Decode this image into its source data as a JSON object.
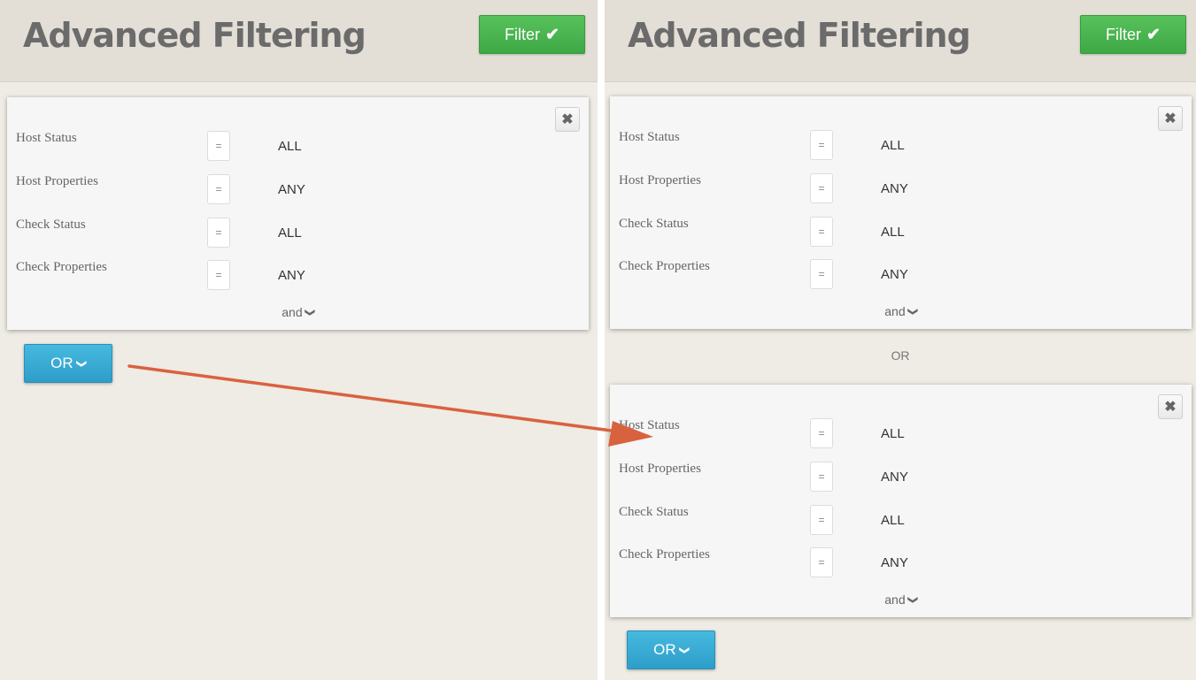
{
  "left_panel": {
    "title": "Advanced Filtering",
    "filter_button": "Filter",
    "or_button": "OR",
    "groups": [
      {
        "rows": [
          {
            "label": "Host Status",
            "operator": "=",
            "value": "ALL"
          },
          {
            "label": "Host Properties",
            "operator": "=",
            "value": "ANY"
          },
          {
            "label": "Check Status",
            "operator": "=",
            "value": "ALL"
          },
          {
            "label": "Check Properties",
            "operator": "=",
            "value": "ANY"
          }
        ],
        "and_label": "and"
      }
    ]
  },
  "right_panel": {
    "title": "Advanced Filtering",
    "filter_button": "Filter",
    "or_button": "OR",
    "or_separator": "OR",
    "groups": [
      {
        "rows": [
          {
            "label": "Host Status",
            "operator": "=",
            "value": "ALL"
          },
          {
            "label": "Host Properties",
            "operator": "=",
            "value": "ANY"
          },
          {
            "label": "Check Status",
            "operator": "=",
            "value": "ALL"
          },
          {
            "label": "Check Properties",
            "operator": "=",
            "value": "ANY"
          }
        ],
        "and_label": "and"
      },
      {
        "rows": [
          {
            "label": "Host Status",
            "operator": "=",
            "value": "ALL"
          },
          {
            "label": "Host Properties",
            "operator": "=",
            "value": "ANY"
          },
          {
            "label": "Check Status",
            "operator": "=",
            "value": "ALL"
          },
          {
            "label": "Check Properties",
            "operator": "=",
            "value": "ANY"
          }
        ],
        "and_label": "and"
      }
    ]
  },
  "icons": {
    "check": "check-icon",
    "chevron": "chevron-down-icon",
    "close": "close-icon"
  },
  "colors": {
    "filter_button": "#4cb352",
    "or_button": "#36a9d4",
    "annotation_arrow": "#d9623e",
    "panel_background": "#efebe5",
    "header_background": "#e3ded6"
  }
}
